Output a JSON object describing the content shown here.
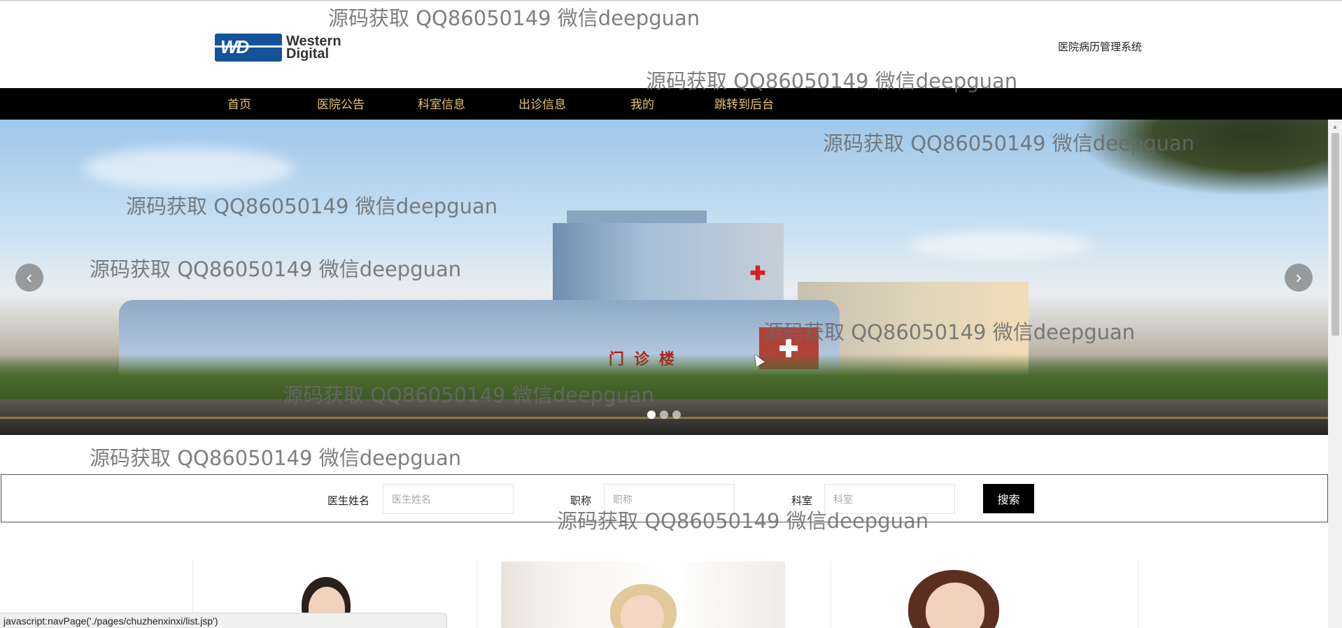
{
  "header": {
    "logo_line1": "Western",
    "logo_line2": "Digital",
    "logo_mark": "WD",
    "site_title": "医院病历管理系统"
  },
  "nav": {
    "items": [
      {
        "label": "首页"
      },
      {
        "label": "医院公告"
      },
      {
        "label": "科室信息"
      },
      {
        "label": "出诊信息"
      },
      {
        "label": "我的"
      },
      {
        "label": "跳转到后台"
      }
    ]
  },
  "banner": {
    "sign_text": "门诊楼",
    "prev_icon": "chevron-left-icon",
    "next_icon": "chevron-right-icon",
    "slide_count": 3,
    "active_slide": 1
  },
  "search": {
    "doctor_name_label": "医生姓名",
    "doctor_name_placeholder": "医生姓名",
    "title_label": "职称",
    "title_placeholder": "职称",
    "department_label": "科室",
    "department_placeholder": "科室",
    "search_button": "搜索"
  },
  "watermark": {
    "text": "源码获取 QQ86050149 微信deepguan"
  },
  "statusbar": {
    "text": "javascript:navPage('./pages/chuzhenxinxi/list.jsp')"
  },
  "colors": {
    "nav_bg": "#000000",
    "nav_text": "#e7c46a",
    "button_bg": "#000000",
    "logo_blue": "#14539a"
  }
}
